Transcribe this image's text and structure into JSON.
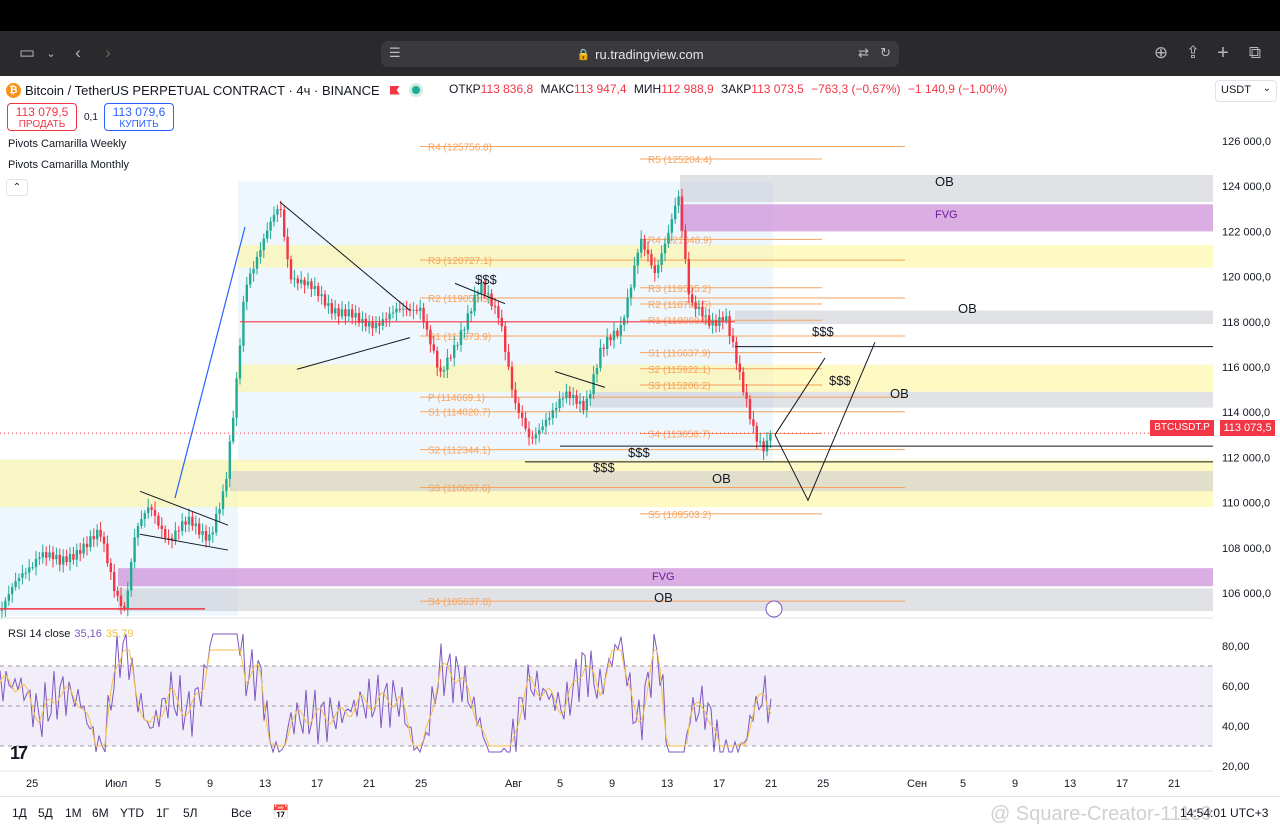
{
  "browser": {
    "url": "ru.tradingview.com"
  },
  "legend": {
    "symbol": "Bitcoin / TetherUS PERPETUAL CONTRACT · 4ч · BINANCE",
    "open_label": "ОТКР",
    "open": "113 836,8",
    "high_label": "МАКС",
    "high": "113 947,4",
    "low_label": "МИН",
    "low": "112 988,9",
    "close_label": "ЗАКР",
    "close": "113 073,5",
    "change": "−763,3 (−0,67%)",
    "change2": "−1 140,9 (−1,00%)"
  },
  "currency": "USDT",
  "trade": {
    "sell_price": "113 079,5",
    "sell_label": "ПРОДАТЬ",
    "spread": "0,1",
    "buy_price": "113 079,6",
    "buy_label": "КУПИТЬ"
  },
  "indicators": [
    "Pivots Camarilla Weekly",
    "Pivots Camarilla Monthly"
  ],
  "rsi": {
    "label": "RSI 14 close",
    "value": "35,16",
    "ma": "35,79"
  },
  "price_axis": [
    "126 000,0",
    "124 000,0",
    "122 000,0",
    "120 000,0",
    "118 000,0",
    "116 000,0",
    "114 000,0",
    "112 000,0",
    "110 000,0",
    "108 000,0",
    "106 000,0"
  ],
  "rsi_axis": [
    "80,00",
    "60,00",
    "40,00",
    "20,00"
  ],
  "time_axis": [
    "25",
    "Июл",
    "5",
    "9",
    "13",
    "17",
    "21",
    "25",
    "Авг",
    "5",
    "9",
    "13",
    "17",
    "21",
    "25",
    "Сен",
    "5",
    "9",
    "13",
    "17",
    "21"
  ],
  "last_price": "113 073,5",
  "symbol_tag": "BTCUSDT.P",
  "pivots": {
    "weekly": [
      {
        "label": "R4 (125756.8)",
        "price": 125756.8
      },
      {
        "label": "R3 (120727.1)",
        "price": 120727.1
      },
      {
        "label": "R2 (119050.5)",
        "price": 119050.5
      },
      {
        "label": "R1 (117373.9)",
        "price": 117373.9
      },
      {
        "label": "P (114669.1)",
        "price": 114669.1
      },
      {
        "label": "S1 (114020.7)",
        "price": 114020.7
      },
      {
        "label": "S2 (112344.1)",
        "price": 112344.1
      },
      {
        "label": "S3 (110667.6)",
        "price": 110667.6
      },
      {
        "label": "S4 (105637.8)",
        "price": 105637.8
      }
    ],
    "monthly": [
      {
        "label": "R5 (125204.4)",
        "price": 125204.4
      },
      {
        "label": "R4 (121648.9)",
        "price": 121648.9
      },
      {
        "label": "R3 (119505.2)",
        "price": 119505.2
      },
      {
        "label": "R2 (118785.5)",
        "price": 118785.5
      },
      {
        "label": "R1 (118069.8)",
        "price": 118069.8
      },
      {
        "label": "S1 (116637.9)",
        "price": 116637.9
      },
      {
        "label": "S2 (115922.1)",
        "price": 115922.1
      },
      {
        "label": "S3 (115206.2)",
        "price": 115206.2
      },
      {
        "label": "S4 (113058.7)",
        "price": 113058.7
      },
      {
        "label": "S5 (109503.2)",
        "price": 109503.2
      }
    ]
  },
  "annotations": {
    "ob": "OB",
    "fvg": "FVG",
    "liq": "$$$"
  },
  "ranges": [
    "1Д",
    "5Д",
    "1М",
    "6М",
    "YTD",
    "1Г",
    "5Л",
    "Все"
  ],
  "clock": "14:54:01 UTC+3",
  "watermark": "@ Square-Creator-111c9",
  "colors": {
    "up": "#22ab94",
    "down": "#f23645",
    "pivot": "#f7a35c",
    "fvg": "#ce93d8",
    "ob": "#c8cbd1",
    "zone": "#fff59d",
    "rsi": "#7e57c2",
    "rsi_ma": "#f5c242"
  }
}
